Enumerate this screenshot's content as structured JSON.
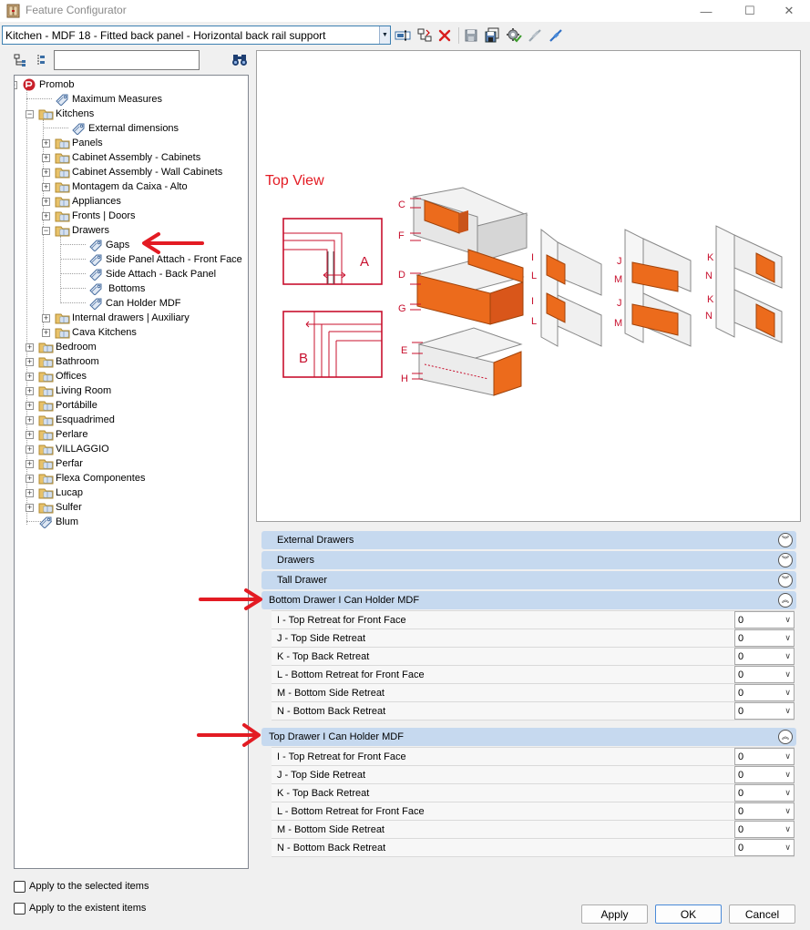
{
  "window": {
    "title": "Feature Configurator",
    "minimize_glyph": "—",
    "maximize_glyph": "☐",
    "close_glyph": "✕"
  },
  "toolbar": {
    "preset_value": "Kitchen - MDF 18 - Fitted back panel - Horizontal back rail support",
    "dropdown_glyph": "▼"
  },
  "tree": {
    "items": [
      {
        "label": "Promob"
      },
      {
        "label": "Maximum Measures"
      },
      {
        "label": "Kitchens"
      },
      {
        "label": "External dimensions"
      },
      {
        "label": "Panels"
      },
      {
        "label": "Cabinet Assembly - Cabinets"
      },
      {
        "label": "Cabinet Assembly - Wall Cabinets"
      },
      {
        "label": "Montagem da Caixa - Alto"
      },
      {
        "label": "Appliances"
      },
      {
        "label": "Fronts | Doors"
      },
      {
        "label": "Drawers"
      },
      {
        "label": "Gaps"
      },
      {
        "label": "Side Panel Attach - Front Face"
      },
      {
        "label": "Side Attach - Back Panel"
      },
      {
        "label": "Bottoms"
      },
      {
        "label": "Can Holder MDF"
      },
      {
        "label": "Internal drawers | Auxiliary"
      },
      {
        "label": "Cava Kitchens"
      },
      {
        "label": "Bedroom"
      },
      {
        "label": "Bathroom"
      },
      {
        "label": "Offices"
      },
      {
        "label": "Living Room"
      },
      {
        "label": "Portábille"
      },
      {
        "label": "Esquadrimed"
      },
      {
        "label": "Perlare"
      },
      {
        "label": "VILLAGGIO"
      },
      {
        "label": "Perfar"
      },
      {
        "label": "Flexa Componentes"
      },
      {
        "label": "Lucap"
      },
      {
        "label": "Sulfer"
      },
      {
        "label": "Blum"
      }
    ]
  },
  "preview": {
    "heading": "Top View",
    "letters": [
      "A",
      "B",
      "C",
      "D",
      "E",
      "F",
      "G",
      "H",
      "I",
      "J",
      "K",
      "L",
      "M",
      "N"
    ]
  },
  "sections": [
    {
      "title": "External Drawers",
      "expanded": false
    },
    {
      "title": "Drawers",
      "expanded": false
    },
    {
      "title": "Tall Drawer",
      "expanded": false
    },
    {
      "title": "Bottom Drawer I Can Holder MDF",
      "expanded": true,
      "rows": [
        {
          "label": "I - Top Retreat for Front Face",
          "value": "0"
        },
        {
          "label": "J - Top Side Retreat",
          "value": "0"
        },
        {
          "label": "K - Top Back Retreat",
          "value": "0"
        },
        {
          "label": "L - Bottom Retreat for Front Face",
          "value": "0"
        },
        {
          "label": "M - Bottom Side Retreat",
          "value": "0"
        },
        {
          "label": "N - Bottom Back Retreat",
          "value": "0"
        }
      ]
    },
    {
      "title": "Top Drawer I Can Holder MDF",
      "expanded": true,
      "rows": [
        {
          "label": "I - Top Retreat for Front Face",
          "value": "0"
        },
        {
          "label": "J - Top Side Retreat",
          "value": "0"
        },
        {
          "label": "K - Top Back Retreat",
          "value": "0"
        },
        {
          "label": "L - Bottom Retreat for Front Face",
          "value": "0"
        },
        {
          "label": "M - Bottom Side Retreat",
          "value": "0"
        },
        {
          "label": "N - Bottom Back Retreat",
          "value": "0"
        }
      ]
    }
  ],
  "glyphs": {
    "collapse_chevron": "︽",
    "expand_chevron": "︾",
    "row_dropdown": "∨",
    "plus": "+",
    "minus": "−"
  },
  "footer": {
    "apply_selected_label": "Apply to the selected items",
    "apply_existent_label": "Apply to the existent items",
    "apply_button": "Apply",
    "ok_button": "OK",
    "cancel_button": "Cancel"
  },
  "colors": {
    "accent": "#c6d9ef",
    "annotation_red": "#e31b23",
    "drawer_orange": "#ec6b1c",
    "folder_yellow": "#e8c26a"
  }
}
